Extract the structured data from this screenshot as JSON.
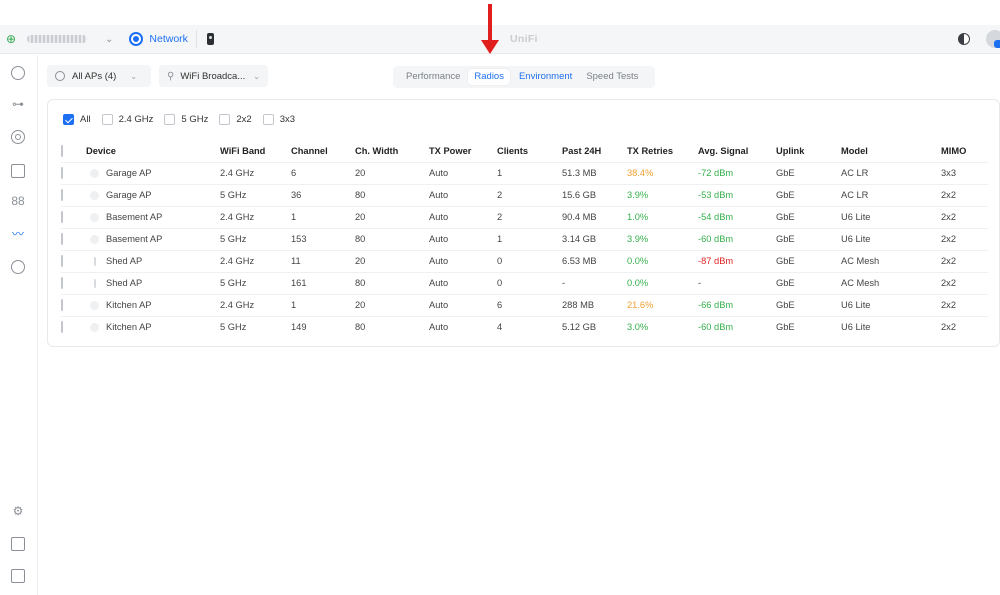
{
  "topbar": {
    "app_name": "Network",
    "title": "UniFi",
    "site_chevron": "⌄"
  },
  "filters": {
    "ap_select": "All APs (4)",
    "ssid_select": "WiFi Broadca...",
    "chevron": "⌄"
  },
  "tabs": [
    {
      "label": "Performance",
      "active": false
    },
    {
      "label": "Radios",
      "active": true
    },
    {
      "label": "Environment",
      "active": false
    },
    {
      "label": "Speed Tests",
      "active": false
    }
  ],
  "chips": [
    {
      "label": "All",
      "checked": true
    },
    {
      "label": "2.4 GHz",
      "checked": false
    },
    {
      "label": "5 GHz",
      "checked": false
    },
    {
      "label": "2x2",
      "checked": false
    },
    {
      "label": "3x3",
      "checked": false
    }
  ],
  "table": {
    "columns": [
      "Device",
      "WiFi Band",
      "Channel",
      "Ch. Width",
      "TX Power",
      "Clients",
      "Past 24H",
      "TX Retries",
      "Avg. Signal",
      "Uplink",
      "Model",
      "MIMO"
    ],
    "rows": [
      {
        "device": "Garage AP",
        "band": "2.4 GHz",
        "channel": "6",
        "width": "20",
        "tx_power": "Auto",
        "clients": "1",
        "past24h": "51.3 MB",
        "retries": "38.4%",
        "retries_level": "orange",
        "signal": "-72 dBm",
        "signal_level": "green",
        "uplink": "GbE",
        "model": "AC LR",
        "mimo": "3x3",
        "icon": "dot"
      },
      {
        "device": "Garage AP",
        "band": "5 GHz",
        "channel": "36",
        "width": "80",
        "tx_power": "Auto",
        "clients": "2",
        "past24h": "15.6 GB",
        "retries": "3.9%",
        "retries_level": "green",
        "signal": "-53 dBm",
        "signal_level": "green",
        "uplink": "GbE",
        "model": "AC LR",
        "mimo": "2x2",
        "icon": "dot"
      },
      {
        "device": "Basement AP",
        "band": "2.4 GHz",
        "channel": "1",
        "width": "20",
        "tx_power": "Auto",
        "clients": "2",
        "past24h": "90.4 MB",
        "retries": "1.0%",
        "retries_level": "green",
        "signal": "-54 dBm",
        "signal_level": "green",
        "uplink": "GbE",
        "model": "U6 Lite",
        "mimo": "2x2",
        "icon": "dot"
      },
      {
        "device": "Basement AP",
        "band": "5 GHz",
        "channel": "153",
        "width": "80",
        "tx_power": "Auto",
        "clients": "1",
        "past24h": "3.14 GB",
        "retries": "3.9%",
        "retries_level": "green",
        "signal": "-60 dBm",
        "signal_level": "green",
        "uplink": "GbE",
        "model": "U6 Lite",
        "mimo": "2x2",
        "icon": "dot"
      },
      {
        "device": "Shed AP",
        "band": "2.4 GHz",
        "channel": "11",
        "width": "20",
        "tx_power": "Auto",
        "clients": "0",
        "past24h": "6.53 MB",
        "retries": "0.0%",
        "retries_level": "green",
        "signal": "-87 dBm",
        "signal_level": "red",
        "uplink": "GbE",
        "model": "AC Mesh",
        "mimo": "2x2",
        "icon": "thin"
      },
      {
        "device": "Shed AP",
        "band": "5 GHz",
        "channel": "161",
        "width": "80",
        "tx_power": "Auto",
        "clients": "0",
        "past24h": "-",
        "retries": "0.0%",
        "retries_level": "green",
        "signal": "-",
        "signal_level": "none",
        "uplink": "GbE",
        "model": "AC Mesh",
        "mimo": "2x2",
        "icon": "thin"
      },
      {
        "device": "Kitchen AP",
        "band": "2.4 GHz",
        "channel": "1",
        "width": "20",
        "tx_power": "Auto",
        "clients": "6",
        "past24h": "288 MB",
        "retries": "21.6%",
        "retries_level": "orange",
        "signal": "-66 dBm",
        "signal_level": "green",
        "uplink": "GbE",
        "model": "U6 Lite",
        "mimo": "2x2",
        "icon": "dot"
      },
      {
        "device": "Kitchen AP",
        "band": "5 GHz",
        "channel": "149",
        "width": "80",
        "tx_power": "Auto",
        "clients": "4",
        "past24h": "5.12 GB",
        "retries": "3.0%",
        "retries_level": "green",
        "signal": "-60 dBm",
        "signal_level": "green",
        "uplink": "GbE",
        "model": "U6 Lite",
        "mimo": "2x2",
        "icon": "dot"
      }
    ]
  },
  "colors": {
    "accent": "#1d6ff2",
    "good": "#35b04c",
    "warn": "#f0a030",
    "bad": "#e02222",
    "annotation_arrow": "#e01e1e"
  },
  "icons": {
    "rail_top": [
      "dashboard-icon",
      "topology-icon",
      "devices-icon",
      "client-devices-icon",
      "statistics-icon",
      "radio-manager-icon",
      "insights-icon"
    ],
    "rail_bottom": [
      "settings-icon",
      "logs-icon",
      "calendar-icon"
    ]
  }
}
